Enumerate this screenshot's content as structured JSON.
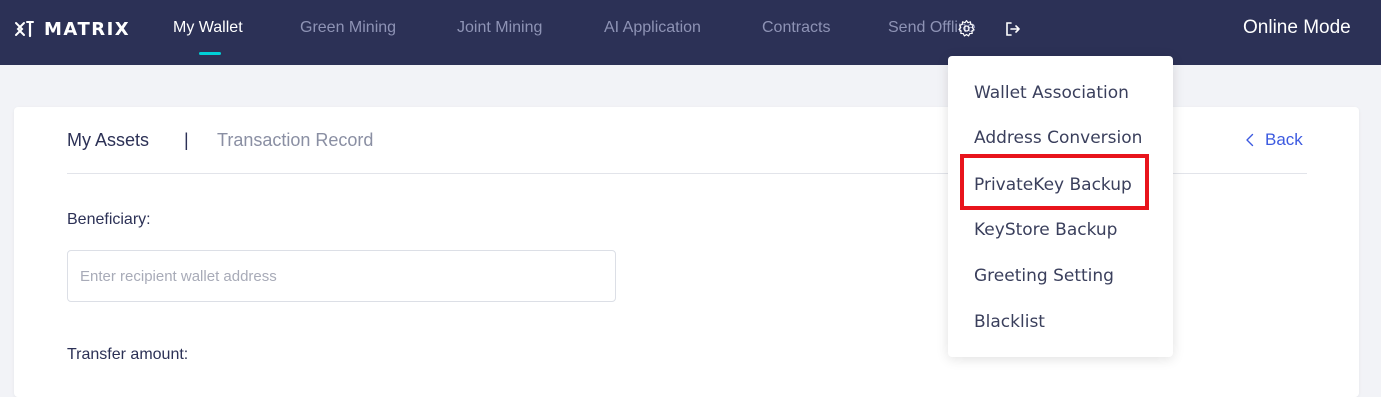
{
  "app": {
    "logo_text": "MATRIX",
    "logo_icon": "matrix-logo-icon"
  },
  "nav": {
    "items": [
      {
        "label": "My Wallet",
        "active": true
      },
      {
        "label": "Green Mining",
        "active": false
      },
      {
        "label": "Joint Mining",
        "active": false
      },
      {
        "label": "AI Application",
        "active": false
      },
      {
        "label": "Contracts",
        "active": false
      },
      {
        "label": "Send Offline",
        "active": false
      }
    ],
    "settings_icon": "gear-icon",
    "logout_icon": "logout-icon",
    "mode_label": "Online Mode"
  },
  "main": {
    "tabs": [
      "My Assets",
      "Transaction Record"
    ],
    "tab_separator": "|",
    "back_label": "Back",
    "beneficiary_label": "Beneficiary:",
    "recipient_placeholder": "Enter recipient wallet address",
    "transfer_amount_label": "Transfer amount:"
  },
  "settings_menu": {
    "items": [
      "Wallet Association",
      "Address Conversion",
      "PrivateKey Backup",
      "KeyStore Backup",
      "Greeting Setting",
      "Blacklist"
    ],
    "highlighted_item": "PrivateKey Backup"
  },
  "colors": {
    "navbar": "#2c3156",
    "active_underline": "#00d0d8",
    "link": "#3c5ae0",
    "highlight": "#e8141c"
  }
}
